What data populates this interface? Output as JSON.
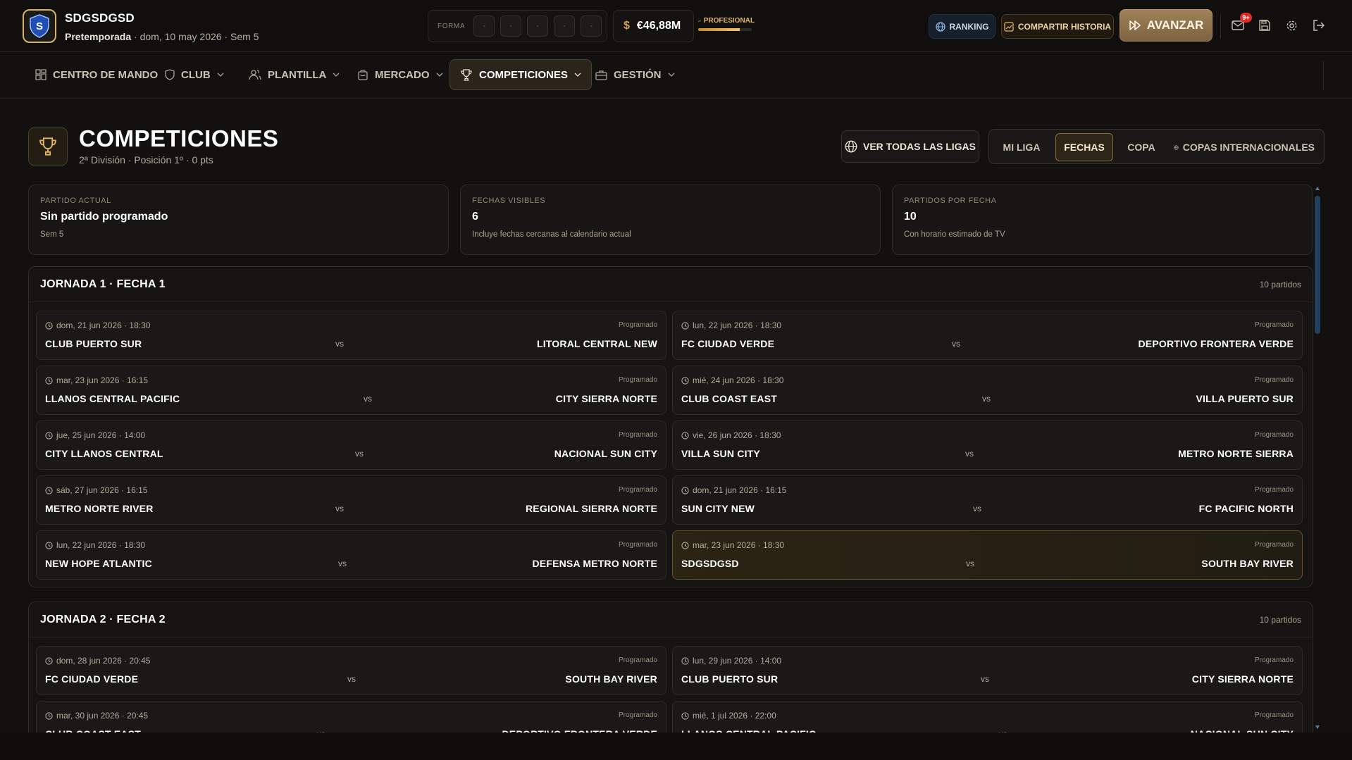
{
  "header": {
    "club_name": "SDGSDGSD",
    "logo_letter": "S",
    "season_phase": "Pretemporada",
    "date_week": "· dom, 10 may 2026 · Sem 5",
    "forma_label": "FORMA",
    "forma_results": [
      "-",
      "-",
      "-",
      "-",
      "-"
    ],
    "budget_symbol": "$",
    "budget": "€46,88M",
    "level_label": "PROFESIONAL",
    "level_progress": 0.78,
    "ranking_label": "RANKING",
    "share_label": "COMPARTIR HISTORIA",
    "advance_label": "AVANZAR",
    "notifications_badge": "9+"
  },
  "nav": {
    "items": [
      {
        "label": "CENTRO DE MANDO",
        "icon": "dashboard-icon"
      },
      {
        "label": "CLUB",
        "icon": "shield-icon"
      },
      {
        "label": "PLANTILLA",
        "icon": "users-icon"
      },
      {
        "label": "MERCADO",
        "icon": "shopping-bag-icon"
      },
      {
        "label": "COMPETICIONES",
        "icon": "trophy-icon"
      },
      {
        "label": "GESTIÓN",
        "icon": "briefcase-icon"
      }
    ]
  },
  "page": {
    "title": "COMPETICIONES",
    "subtitle": "2ª División · Posición 1º · 0 pts",
    "all_leagues_label": "VER TODAS LAS LIGAS",
    "tabs": [
      "MI LIGA",
      "FECHAS",
      "COPA",
      "COPAS INTERNACIONALES"
    ],
    "active_tab": "FECHAS"
  },
  "stats": [
    {
      "label": "PARTIDO ACTUAL",
      "value": "Sin partido programado",
      "note": "Sem 5"
    },
    {
      "label": "FECHAS VISIBLES",
      "value": "6",
      "note": "Incluye fechas cercanas al calendario actual"
    },
    {
      "label": "PARTIDOS POR FECHA",
      "value": "10",
      "note": "Con horario estimado de TV"
    }
  ],
  "rounds": [
    {
      "title": "JORNADA 1 · FECHA 1",
      "count": "10 partidos",
      "matches": [
        {
          "date": "dom, 21 jun 2026 · 18:30",
          "status": "Programado",
          "home": "CLUB PUERTO SUR",
          "vs": "vs",
          "away": "LITORAL CENTRAL NEW"
        },
        {
          "date": "lun, 22 jun 2026 · 18:30",
          "status": "Programado",
          "home": "FC CIUDAD VERDE",
          "vs": "vs",
          "away": "DEPORTIVO FRONTERA VERDE"
        },
        {
          "date": "mar, 23 jun 2026 · 16:15",
          "status": "Programado",
          "home": "LLANOS CENTRAL PACIFIC",
          "vs": "vs",
          "away": "CITY SIERRA NORTE"
        },
        {
          "date": "mié, 24 jun 2026 · 18:30",
          "status": "Programado",
          "home": "CLUB COAST EAST",
          "vs": "vs",
          "away": "VILLA PUERTO SUR"
        },
        {
          "date": "jue, 25 jun 2026 · 14:00",
          "status": "Programado",
          "home": "CITY LLANOS CENTRAL",
          "vs": "vs",
          "away": "NACIONAL SUN CITY"
        },
        {
          "date": "vie, 26 jun 2026 · 18:30",
          "status": "Programado",
          "home": "VILLA SUN CITY",
          "vs": "vs",
          "away": "METRO NORTE SIERRA"
        },
        {
          "date": "sáb, 27 jun 2026 · 16:15",
          "status": "Programado",
          "home": "METRO NORTE RIVER",
          "vs": "vs",
          "away": "REGIONAL SIERRA NORTE"
        },
        {
          "date": "dom, 21 jun 2026 · 16:15",
          "status": "Programado",
          "home": "SUN CITY NEW",
          "vs": "vs",
          "away": "FC PACIFIC NORTH"
        },
        {
          "date": "lun, 22 jun 2026 · 18:30",
          "status": "Programado",
          "home": "NEW HOPE ATLANTIC",
          "vs": "vs",
          "away": "DEFENSA METRO NORTE"
        },
        {
          "date": "mar, 23 jun 2026 · 18:30",
          "status": "Programado",
          "home": "SDGSDGSD",
          "vs": "vs",
          "away": "SOUTH BAY RIVER",
          "mine": true
        }
      ]
    },
    {
      "title": "JORNADA 2 · FECHA 2",
      "count": "10 partidos",
      "matches": [
        {
          "date": "dom, 28 jun 2026 · 20:45",
          "status": "Programado",
          "home": "FC CIUDAD VERDE",
          "vs": "vs",
          "away": "SOUTH BAY RIVER"
        },
        {
          "date": "lun, 29 jun 2026 · 14:00",
          "status": "Programado",
          "home": "CLUB PUERTO SUR",
          "vs": "vs",
          "away": "CITY SIERRA NORTE"
        },
        {
          "date": "mar, 30 jun 2026 · 20:45",
          "status": "Programado",
          "home": "CLUB COAST EAST",
          "vs": "vs",
          "away": "DEPORTIVO FRONTERA VERDE"
        },
        {
          "date": "mié, 1 jul 2026 · 22:00",
          "status": "Programado",
          "home": "LLANOS CENTRAL PACIFIC",
          "vs": "vs",
          "away": "NACIONAL SUN CITY"
        }
      ]
    }
  ],
  "colors": {
    "accent": "#d8b469",
    "background": "#121110",
    "highlight_border": "#6b5328",
    "ranking_blue": "#15202c"
  }
}
